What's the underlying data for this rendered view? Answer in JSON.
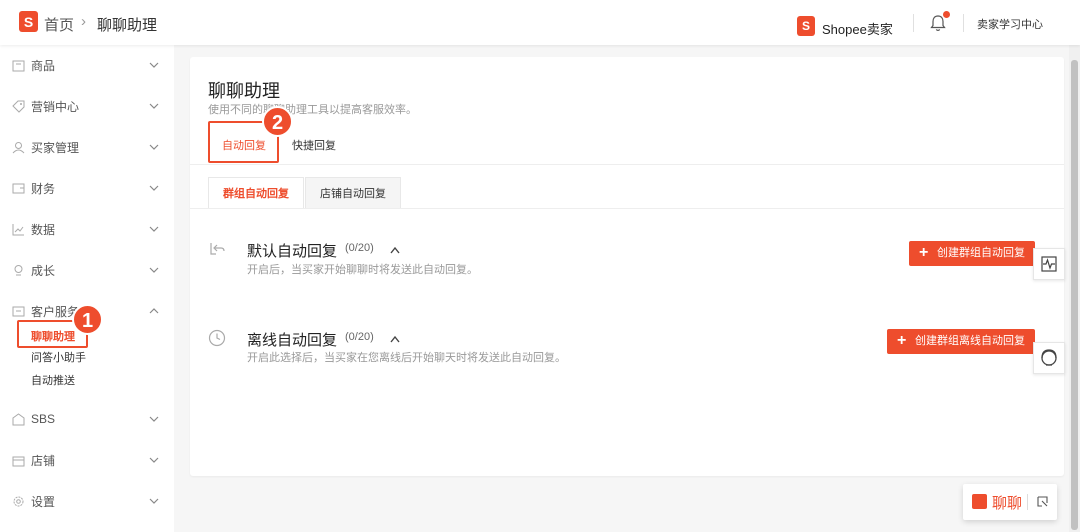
{
  "header": {
    "logo_letter": "S",
    "breadcrumb_home": "首页",
    "breadcrumb_sep": "›",
    "breadcrumb_current": "聊聊助理",
    "brand_letter": "S",
    "brand_text": "Shopee卖家",
    "learning_center": "卖家学习中心"
  },
  "sidebar": {
    "items": [
      {
        "label": "商品"
      },
      {
        "label": "营销中心"
      },
      {
        "label": "买家管理"
      },
      {
        "label": "财务"
      },
      {
        "label": "数据"
      },
      {
        "label": "成长"
      },
      {
        "label": "客户服务"
      },
      {
        "label": "SBS"
      },
      {
        "label": "店铺"
      },
      {
        "label": "设置"
      }
    ],
    "sub_items": [
      {
        "label": "聊聊助理"
      },
      {
        "label": "问答小助手"
      },
      {
        "label": "自动推送"
      }
    ]
  },
  "annotations": {
    "step1": "1",
    "step2": "2"
  },
  "main": {
    "title": "聊聊助理",
    "subtitle": "使用不同的聊聊助理工具以提高客服效率。",
    "tabs": [
      {
        "label": "自动回复"
      },
      {
        "label": "快捷回复"
      }
    ],
    "subtabs": [
      {
        "label": "群组自动回复"
      },
      {
        "label": "店铺自动回复"
      }
    ],
    "sections": [
      {
        "title": "默认自动回复",
        "count": "(0/20)",
        "desc": "开启后，当买家开始聊聊时将发送此自动回复。",
        "button": "创建群组自动回复"
      },
      {
        "title": "离线自动回复",
        "count": "(0/20)",
        "desc": "开启此选择后，当买家在您离线后开始聊天时将发送此自动回复。",
        "button": "创建群组离线自动回复"
      }
    ]
  },
  "chat_widget": {
    "label": "聊聊"
  },
  "colors": {
    "accent": "#ee4d2d"
  }
}
